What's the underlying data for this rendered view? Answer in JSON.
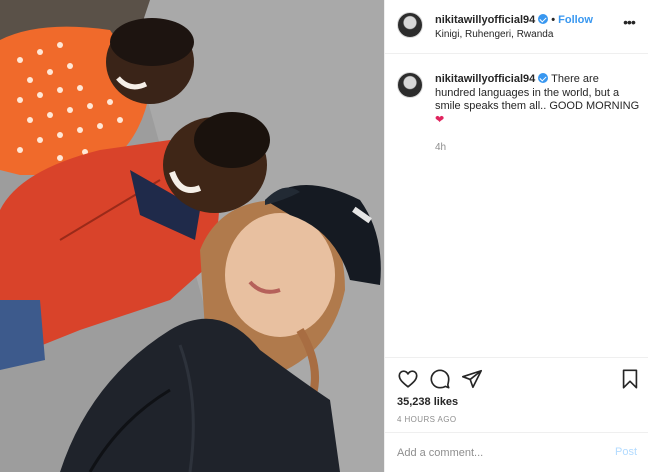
{
  "photo": {
    "alt_icon": "post-photo"
  },
  "header": {
    "username": "nikitawillyofficial94",
    "separator": "•",
    "follow_label": "Follow",
    "location": "Kinigi, Ruhengeri, Rwanda",
    "more_icon": "more-options-icon",
    "more_glyph": "•••"
  },
  "caption": {
    "username": "nikitawillyofficial94",
    "text": "There are hundred languages in the world, but a smile speaks them all.. GOOD MORNING",
    "emoji": "❤",
    "time_ago": "4h"
  },
  "actions": {
    "like_icon": "heart-icon",
    "comment_icon": "comment-icon",
    "share_icon": "share-icon",
    "save_icon": "bookmark-icon"
  },
  "likes": "35,238 likes",
  "posted": "4 HOURS AGO",
  "comment_box": {
    "placeholder": "Add a comment...",
    "post_label": "Post"
  },
  "colors": {
    "link": "#3897f0",
    "post_disabled": "#b3dbff",
    "border": "#efefef",
    "muted": "#8e8e8e",
    "text": "#262626"
  }
}
